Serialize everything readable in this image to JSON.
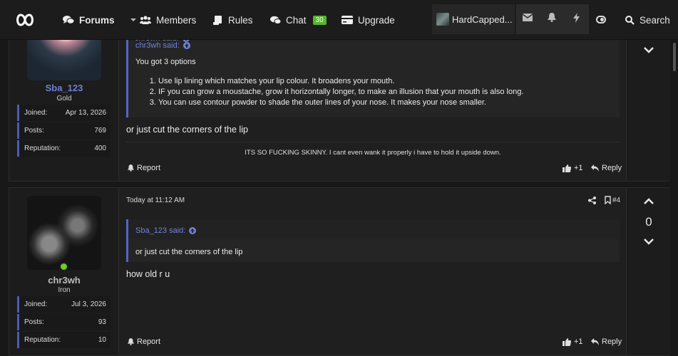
{
  "nav": {
    "forums": "Forums",
    "members": "Members",
    "rules": "Rules",
    "chat": "Chat",
    "chat_count": "30",
    "upgrade": "Upgrade",
    "user": "HardCapped...",
    "search": "Search"
  },
  "post1": {
    "username": "Sba_123",
    "title": "Gold",
    "joined_label": "Joined:",
    "joined": "Apr 13, 2026",
    "posts_label": "Posts:",
    "posts": "769",
    "rep_label": "Reputation:",
    "rep": "400",
    "quote_author": "chr3wh said:",
    "quote_intro": "You got 3 options",
    "quote_items": [
      "Use lip lining which matches your lip colour. It broadens your mouth.",
      "IF you can grow a moustache, grow it horizontally longer, to make an illusion that your mouth is also long.",
      "You can use contour powder to shade the outer lines of your nose. It makes your nose smaller."
    ],
    "text": "or just cut the corners of the lip",
    "signature": "ITS SO FUCKING SKINNY. I cant even wank it properly i have to hold it upside down.",
    "report": "Report",
    "like": "+1",
    "reply": "Reply"
  },
  "post2": {
    "username": "chr3wh",
    "title": "Iron",
    "joined_label": "Joined:",
    "joined": "Jul 3, 2026",
    "posts_label": "Posts:",
    "posts": "93",
    "rep_label": "Reputation:",
    "rep": "10",
    "date": "Today at 11:12 AM",
    "number": "#4",
    "score": "0",
    "quote_author": "Sba_123 said:",
    "quote_text": "or just cut the corners of the lip",
    "text": "how old r u",
    "report": "Report",
    "like": "+1",
    "reply": "Reply"
  }
}
